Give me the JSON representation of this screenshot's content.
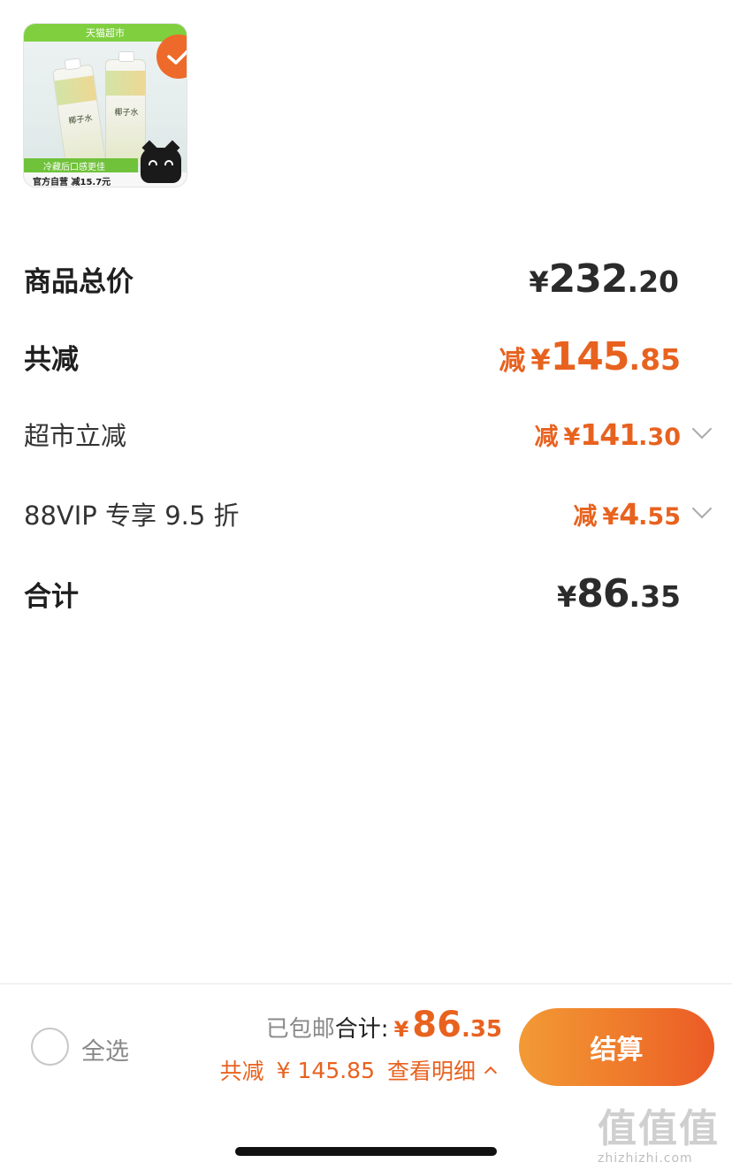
{
  "product": {
    "top_banner": "天猫超市",
    "bottle_label": "椰子水",
    "promo_strip": "冷藏后口感更佳",
    "bottom_strip": "官方自营 减15.7元",
    "selected": true
  },
  "summary": {
    "rows": [
      {
        "label": "商品总价",
        "prefix": "",
        "yen": "¥",
        "int": "232",
        "dec": ".20",
        "color": "dark",
        "expandable": false
      },
      {
        "label": "共减",
        "prefix": "减",
        "yen": "¥",
        "int": "145",
        "dec": ".85",
        "color": "orange",
        "expandable": false
      },
      {
        "label": "超市立减",
        "prefix": "减",
        "yen": "¥",
        "int": "141",
        "dec": ".30",
        "color": "orange",
        "expandable": true
      },
      {
        "label": "88VIP 专享 9.5 折",
        "prefix": "减",
        "yen": "¥",
        "int": "4",
        "dec": ".55",
        "color": "orange",
        "expandable": true
      },
      {
        "label": "合计",
        "prefix": "",
        "yen": "¥",
        "int": "86",
        "dec": ".35",
        "color": "dark",
        "expandable": false
      }
    ]
  },
  "bottom_bar": {
    "select_all": "全选",
    "shipping": "已包邮",
    "total_label": "合计:",
    "total_yen": "¥",
    "total_int": "86",
    "total_dec": ".35",
    "discount_label": "共减",
    "discount_value": "¥ 145.85",
    "detail_link": "查看明细",
    "checkout": "结算"
  },
  "watermark": {
    "glyphs": "值值值",
    "url": "zhizhizhi.com"
  },
  "colors": {
    "accent": "#e8621f",
    "checkout_start": "#f29a35",
    "checkout_end": "#eb5a26"
  }
}
